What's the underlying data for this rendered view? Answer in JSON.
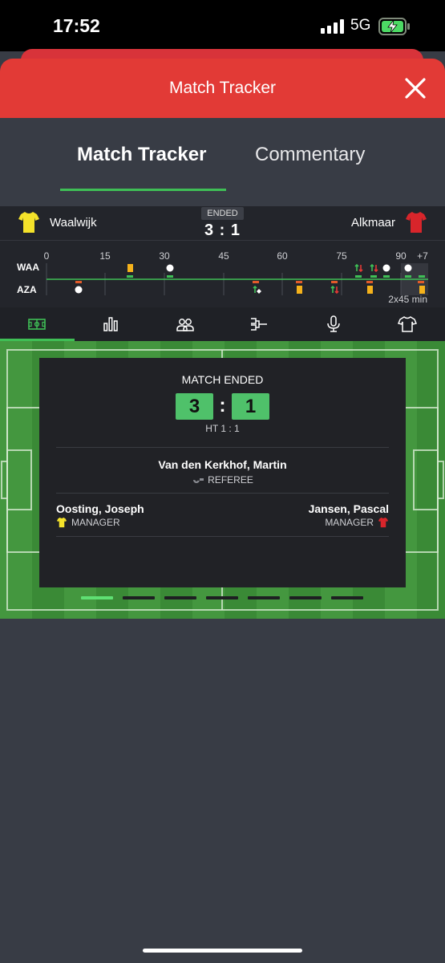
{
  "status_bar": {
    "time": "17:52",
    "network": "5G"
  },
  "sheet": {
    "title": "Match Tracker"
  },
  "tabs": [
    {
      "label": "Match Tracker"
    },
    {
      "label": "Commentary"
    }
  ],
  "match": {
    "home": {
      "name": "Waalwijk",
      "code": "WAA",
      "shirt_color": "#f4e22a"
    },
    "away": {
      "name": "Alkmaar",
      "code": "AZA",
      "shirt_color": "#d8252b"
    },
    "status": "ENDED",
    "score_line": "3 : 1"
  },
  "timeline": {
    "ticks": [
      "0",
      "15",
      "30",
      "45",
      "60",
      "75",
      "90",
      "+7"
    ],
    "duration": "2x45 min"
  },
  "icon_tabs": [
    {
      "icon": "pitch-icon"
    },
    {
      "icon": "stats-icon"
    },
    {
      "icon": "lineups-icon"
    },
    {
      "icon": "bracket-icon"
    },
    {
      "icon": "microphone-icon"
    },
    {
      "icon": "shirt-icon"
    }
  ],
  "summary": {
    "status": "MATCH ENDED",
    "home_goals": "3",
    "away_goals": "1",
    "separator": ":",
    "halftime": "HT  1 : 1",
    "referee": {
      "name": "Van den Kerkhof, Martin",
      "role": "REFEREE"
    },
    "home_manager": {
      "name": "Oosting, Joseph",
      "role": "MANAGER"
    },
    "away_manager": {
      "name": "Jansen, Pascal",
      "role": "MANAGER"
    }
  },
  "pager": {
    "count": 7,
    "active_index": 0
  },
  "colors": {
    "accent": "#3fbf56",
    "header_red": "#e23a36",
    "score_green": "#4fc16a",
    "yellow_card": "#f5b21b"
  }
}
